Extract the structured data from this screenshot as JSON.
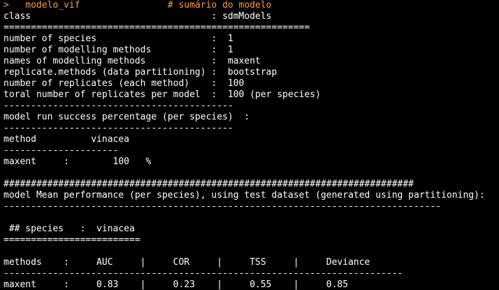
{
  "console": {
    "prompt": ">",
    "command": "   modelo_vif",
    "comment": "                # sumário do modelo",
    "lines": [
      "class                                 : sdmModels",
      "========================================================",
      "number of species                     :  1",
      "number of modelling methods           :  1",
      "names of modelling methods            :  maxent",
      "replicate.methods (data partitioning) :  bootstrap",
      "number of replicates (each method)    :  100",
      "toral number of replicates per model  :  100 (per species)",
      "------------------------------------------",
      "model run success percentage (per species)  :",
      "------------------------------------------",
      "method          vinacea",
      "---------------------",
      "maxent     :        100   %",
      "",
      "###########################################################################",
      "model Mean performance (per species), using test dataset (generated using partitioning):",
      "--------------------------------------------------------------------------------",
      "",
      " ## species   :  vinacea",
      "=========================",
      "",
      "methods    :     AUC     |     COR     |     TSS     |     Deviance",
      "-------------------------------------------------------------------------",
      "maxent     :     0.83    |     0.23    |     0.55    |     0.85"
    ]
  },
  "colors": {
    "background": "#000000",
    "text": "#ffffff",
    "prompt": "#ff9a3c"
  }
}
